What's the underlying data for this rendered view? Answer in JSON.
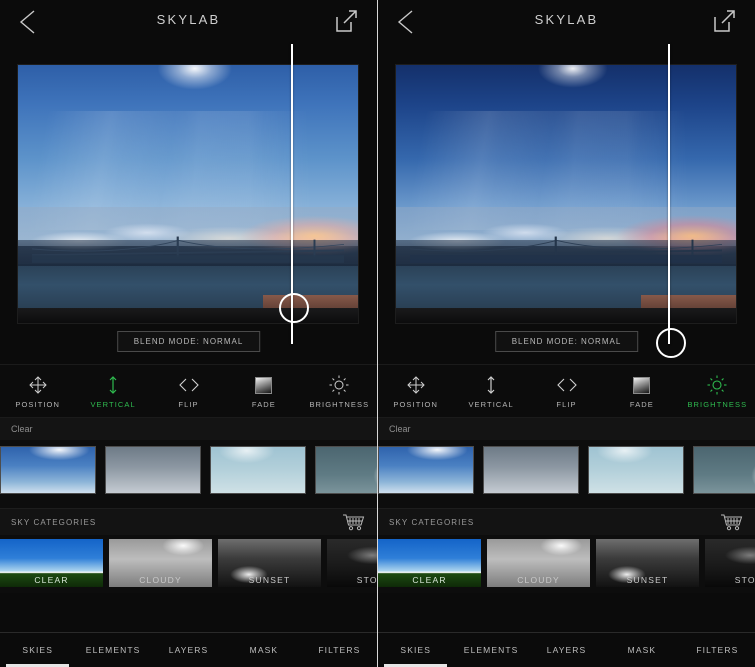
{
  "header": {
    "title": "SKYLAB",
    "back_icon": "chevron-left-icon",
    "share_icon": "share-export-icon"
  },
  "editor": {
    "blend_mode_label": "BLEND MODE: NORMAL",
    "slider_line": "vertical-slider-line",
    "slider_handle": "slider-handle"
  },
  "tools": [
    {
      "label": "POSITION",
      "icon": "move-arrows-icon",
      "active_left": false,
      "active_right": false
    },
    {
      "label": "VERTICAL",
      "icon": "vertical-arrow-icon",
      "active_left": true,
      "active_right": false
    },
    {
      "label": "FLIP",
      "icon": "flip-chevrons-icon",
      "active_left": false,
      "active_right": false
    },
    {
      "label": "FADE",
      "icon": "gradient-square-icon",
      "active_left": false,
      "active_right": false
    },
    {
      "label": "BRIGHTNESS",
      "icon": "sun-icon",
      "active_left": false,
      "active_right": true
    }
  ],
  "sky_strip": {
    "group_label": "Clear",
    "thumbnails": [
      "sky-thumb-blue-sky",
      "sky-thumb-gray-gradient",
      "sky-thumb-pale-blue",
      "sky-thumb-teal-sunburst"
    ]
  },
  "categories_section": {
    "title": "SKY CATEGORIES",
    "cart_icon": "shopping-cart-icon",
    "items": [
      {
        "label": "CLEAR",
        "selected": true
      },
      {
        "label": "CLOUDY",
        "selected": false
      },
      {
        "label": "SUNSET",
        "selected": false
      },
      {
        "label": "STORMY",
        "selected": false
      }
    ]
  },
  "bottom_tabs": [
    {
      "label": "SKIES",
      "active": true
    },
    {
      "label": "ELEMENTS",
      "active": false
    },
    {
      "label": "LAYERS",
      "active": false
    },
    {
      "label": "MASK",
      "active": false
    },
    {
      "label": "FILTERS",
      "active": false
    }
  ],
  "colors": {
    "accent_green": "#2fbb4f",
    "background": "#0b0b0b",
    "text_primary": "#cfcfcf"
  }
}
